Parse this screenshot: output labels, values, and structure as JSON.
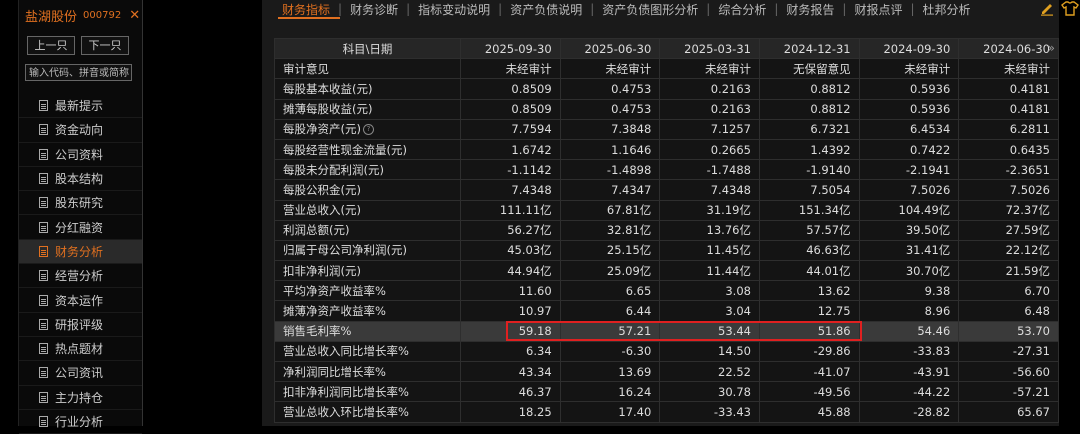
{
  "stock": {
    "name": "盐湖股份",
    "code": "000792",
    "close_symbol": "✕"
  },
  "nav": {
    "prev": "上一只",
    "next": "下一只",
    "search_placeholder": "输入代码、拼音或简称"
  },
  "menu": [
    {
      "label": "最新提示",
      "active": false
    },
    {
      "label": "资金动向",
      "active": false
    },
    {
      "label": "公司资料",
      "active": false
    },
    {
      "label": "股本结构",
      "active": false
    },
    {
      "label": "股东研究",
      "active": false
    },
    {
      "label": "分红融资",
      "active": false
    },
    {
      "label": "财务分析",
      "active": true
    },
    {
      "label": "经营分析",
      "active": false
    },
    {
      "label": "资本运作",
      "active": false
    },
    {
      "label": "研报评级",
      "active": false
    },
    {
      "label": "热点题材",
      "active": false
    },
    {
      "label": "公司资讯",
      "active": false
    },
    {
      "label": "主力持仓",
      "active": false
    },
    {
      "label": "行业分析",
      "active": false
    }
  ],
  "tabs": [
    {
      "label": "财务指标",
      "active": true
    },
    {
      "label": "财务诊断",
      "active": false
    },
    {
      "label": "指标变动说明",
      "active": false
    },
    {
      "label": "资产负债说明",
      "active": false
    },
    {
      "label": "资产负债图形分析",
      "active": false
    },
    {
      "label": "综合分析",
      "active": false
    },
    {
      "label": "财务报告",
      "active": false
    },
    {
      "label": "财报点评",
      "active": false
    },
    {
      "label": "杜邦分析",
      "active": false
    }
  ],
  "table": {
    "header": [
      "科目\\日期",
      "2025-09-30",
      "2025-06-30",
      "2025-03-31",
      "2024-12-31",
      "2024-09-30",
      "2024-06-30"
    ],
    "more_symbol": "»",
    "rows": [
      {
        "label": "审计意见",
        "values": [
          "未经审计",
          "未经审计",
          "未经审计",
          "无保留意见",
          "未经审计",
          "未经审计"
        ]
      },
      {
        "label": "每股基本收益(元)",
        "values": [
          "0.8509",
          "0.4753",
          "0.2163",
          "0.8812",
          "0.5936",
          "0.4181"
        ]
      },
      {
        "label": "摊薄每股收益(元)",
        "values": [
          "0.8509",
          "0.4753",
          "0.2163",
          "0.8812",
          "0.5936",
          "0.4181"
        ]
      },
      {
        "label": "每股净资产(元)",
        "help": "?",
        "values": [
          "7.7594",
          "7.3848",
          "7.1257",
          "6.7321",
          "6.4534",
          "6.2811"
        ]
      },
      {
        "label": "每股经营性现金流量(元)",
        "values": [
          "1.6742",
          "1.1646",
          "0.2665",
          "1.4392",
          "0.7422",
          "0.6435"
        ]
      },
      {
        "label": "每股未分配利润(元)",
        "values": [
          "-1.1142",
          "-1.4898",
          "-1.7488",
          "-1.9140",
          "-2.1941",
          "-2.3651"
        ]
      },
      {
        "label": "每股公积金(元)",
        "values": [
          "7.4348",
          "7.4347",
          "7.4348",
          "7.5054",
          "7.5026",
          "7.5026"
        ]
      },
      {
        "label": "营业总收入(元)",
        "values": [
          "111.11亿",
          "67.81亿",
          "31.19亿",
          "151.34亿",
          "104.49亿",
          "72.37亿"
        ]
      },
      {
        "label": "利润总额(元)",
        "values": [
          "56.27亿",
          "32.81亿",
          "13.76亿",
          "57.57亿",
          "39.50亿",
          "27.59亿"
        ]
      },
      {
        "label": "归属于母公司净利润(元)",
        "values": [
          "45.03亿",
          "25.15亿",
          "11.45亿",
          "46.63亿",
          "31.41亿",
          "22.12亿"
        ]
      },
      {
        "label": "扣非净利润(元)",
        "values": [
          "44.94亿",
          "25.09亿",
          "11.44亿",
          "44.01亿",
          "30.70亿",
          "21.59亿"
        ]
      },
      {
        "label": "平均净资产收益率%",
        "values": [
          "11.60",
          "6.65",
          "3.08",
          "13.62",
          "9.38",
          "6.70"
        ]
      },
      {
        "label": "摊薄净资产收益率%",
        "values": [
          "10.97",
          "6.44",
          "3.04",
          "12.75",
          "8.96",
          "6.48"
        ]
      },
      {
        "label": "销售毛利率%",
        "highlight": true,
        "values": [
          "59.18",
          "57.21",
          "53.44",
          "51.86",
          "54.46",
          "53.70"
        ]
      },
      {
        "label": "营业总收入同比增长率%",
        "values": [
          "6.34",
          "-6.30",
          "14.50",
          "-29.86",
          "-33.83",
          "-27.31"
        ]
      },
      {
        "label": "净利润同比增长率%",
        "values": [
          "43.34",
          "13.69",
          "22.52",
          "-41.07",
          "-43.91",
          "-56.60"
        ]
      },
      {
        "label": "扣非净利润同比增长率%",
        "values": [
          "46.37",
          "16.24",
          "30.78",
          "-49.56",
          "-44.22",
          "-57.21"
        ]
      },
      {
        "label": "营业总收入环比增长率%",
        "values": [
          "18.25",
          "17.40",
          "-33.43",
          "45.88",
          "-28.82",
          "65.67"
        ]
      }
    ]
  },
  "colors": {
    "accent": "#e07020",
    "highlight_border": "#e02020"
  },
  "icons": [
    "edit-icon",
    "shirt-icon",
    "doc-icon"
  ]
}
